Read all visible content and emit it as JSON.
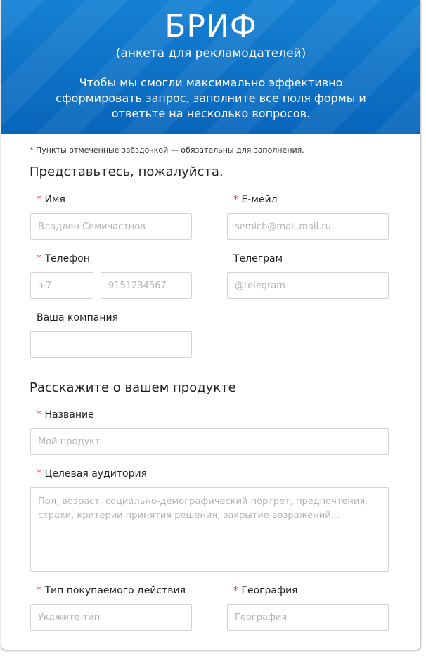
{
  "header": {
    "title": "БРИФ",
    "subtitle": "(анкета для рекламодателей)",
    "description": "Чтобы мы смогли максимально эффективно сформировать запрос, заполните все поля формы и ответьте на несколько вопросов."
  },
  "note": {
    "asterisk": "*",
    "text": "Пункты отмеченные звёздочкой — обязательны для заполнения."
  },
  "section1": {
    "title": "Представьтесь, пожалуйста.",
    "name": {
      "label": "Имя",
      "placeholder": "Владлен Семичастнов"
    },
    "email": {
      "label": "Е-мейл",
      "placeholder": "semich@mail.mail.ru"
    },
    "phone": {
      "label": "Телефон",
      "code_placeholder": "+7",
      "number_placeholder": "9151234567"
    },
    "telegram": {
      "label": "Телеграм",
      "placeholder": "@telegram"
    },
    "company": {
      "label": "Ваша компания",
      "placeholder": ""
    }
  },
  "section2": {
    "title": "Расскажите о вашем продукте",
    "product": {
      "label": "Название",
      "placeholder": "Мой продукт"
    },
    "audience": {
      "label": "Целевая аудитория",
      "placeholder": "Пол, возраст, социально-демографический портрет, предпочтения, страхи, критерии принятия решения, закрытие возражений..."
    },
    "action": {
      "label": "Тип покупаемого действия",
      "placeholder": "Укажите тип"
    },
    "geo": {
      "label": "География",
      "placeholder": "География"
    }
  },
  "colors": {
    "header_blue": "#0a6fc5",
    "required_red": "#e0322a"
  }
}
